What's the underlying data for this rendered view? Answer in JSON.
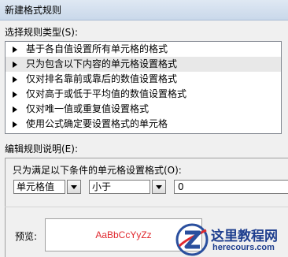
{
  "dialog": {
    "title": "新建格式规则"
  },
  "rule_type": {
    "label": "选择规则类型(S):",
    "items": [
      {
        "label": "基于各自值设置所有单元格的格式"
      },
      {
        "label": "只为包含以下内容的单元格设置格式"
      },
      {
        "label": "仅对排名靠前或靠后的数值设置格式"
      },
      {
        "label": "仅对高于或低于平均值的数值设置格式"
      },
      {
        "label": "仅对唯一值或重复值设置格式"
      },
      {
        "label": "使用公式确定要设置格式的单元格"
      }
    ],
    "selected_index": 1
  },
  "rule_description": {
    "label": "编辑规则说明(E):",
    "condition_label": "只为满足以下条件的单元格设置格式(O):",
    "field_select": "单元格值",
    "operator_select": "小于",
    "value_input": "0",
    "preview_label": "预览:",
    "preview_text": "AaBbCcYyZz",
    "preview_color": "#e0282e"
  },
  "watermark": {
    "title": "这里教程网",
    "url": "herecours.com"
  }
}
